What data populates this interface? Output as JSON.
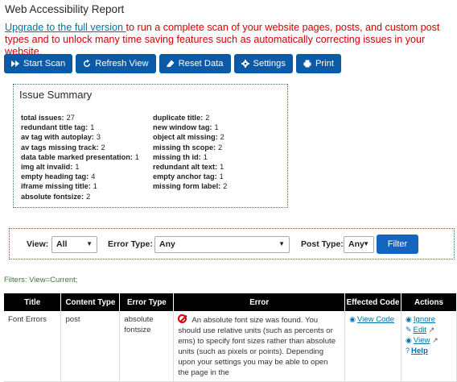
{
  "page_title": "Web Accessibility Report",
  "upgrade": {
    "link_text": "Upgrade to the full version ",
    "text": "to run a complete scan of your website pages, posts, and custom post types and to unlock many time saving features such as automatically correcting issues in your website."
  },
  "toolbar": [
    {
      "label": "Start Scan",
      "icon": "fast-forward-icon",
      "name": "start-scan-button"
    },
    {
      "label": "Refresh View",
      "icon": "refresh-icon",
      "name": "refresh-view-button"
    },
    {
      "label": "Reset Data",
      "icon": "eraser-icon",
      "name": "reset-data-button"
    },
    {
      "label": "Settings",
      "icon": "gear-icon",
      "name": "settings-button"
    },
    {
      "label": "Print",
      "icon": "print-icon",
      "name": "print-button"
    }
  ],
  "summary": {
    "title": "Issue Summary",
    "left": [
      {
        "label": "total issues:",
        "value": "27"
      },
      {
        "label": "redundant title tag:",
        "value": "1"
      },
      {
        "label": "av tag with autoplay:",
        "value": "3"
      },
      {
        "label": "av tags missing track:",
        "value": "2"
      },
      {
        "label": "data table marked presentation:",
        "value": "1"
      },
      {
        "label": "img alt invalid:",
        "value": "1"
      },
      {
        "label": "empty heading tag:",
        "value": "4"
      },
      {
        "label": "iframe missing title:",
        "value": "1"
      },
      {
        "label": "absolute fontsize:",
        "value": "2"
      }
    ],
    "right": [
      {
        "label": "duplicate title:",
        "value": "2"
      },
      {
        "label": "new window tag:",
        "value": "1"
      },
      {
        "label": "object alt missing:",
        "value": "2"
      },
      {
        "label": "missing th scope:",
        "value": "2"
      },
      {
        "label": "missing th id:",
        "value": "1"
      },
      {
        "label": "redundant alt text:",
        "value": "1"
      },
      {
        "label": "empty anchor tag:",
        "value": "1"
      },
      {
        "label": "missing form label:",
        "value": "2"
      }
    ]
  },
  "filters": {
    "view_label": "View:",
    "view_value": "All",
    "error_type_label": "Error Type:",
    "error_type_value": "Any",
    "post_type_label": "Post Type:",
    "post_type_value": "Any",
    "filter_button": "Filter"
  },
  "filters_status": "Filters: View=Current;",
  "table": {
    "headers": [
      "Title",
      "Content Type",
      "Error Type",
      "Error",
      "Effected Code",
      "Actions"
    ],
    "row": {
      "title": "Font Errors",
      "content_type": "post",
      "error_type": "absolute fontsize",
      "error": "An absolute font size was found. You should use relative units (such as percents or ems) to specify font sizes rather than absolute units (such as pixels or points). Depending upon your settings you may be able to open the page in the",
      "effected_code": "View Code",
      "actions": {
        "ignore": "Ignore",
        "edit": "Edit",
        "view": "View",
        "help": "Help"
      }
    }
  }
}
